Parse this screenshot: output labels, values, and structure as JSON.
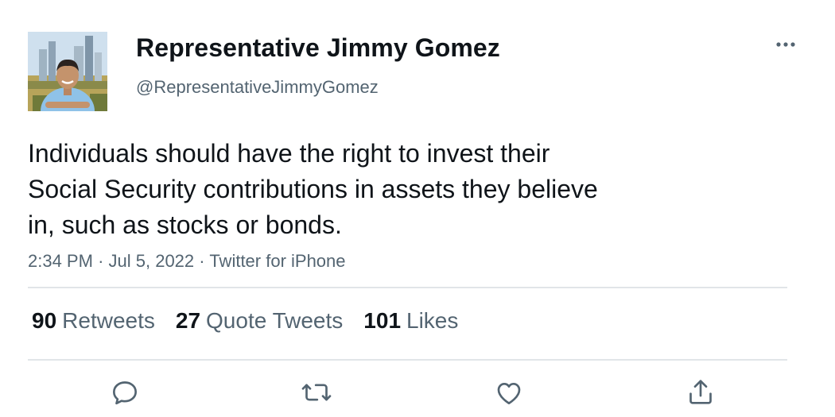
{
  "author": {
    "display_name": "Representative Jimmy Gomez",
    "handle": "@RepresentativeJimmyGomez",
    "avatar_icon": "profile-photo"
  },
  "tweet": {
    "text": "Individuals should have the right to invest their\nSocial Security contributions in assets they believe\nin, such as stocks or bonds.",
    "time": "2:34 PM",
    "separator": "·",
    "date": "Jul 5, 2022",
    "source": "Twitter for iPhone"
  },
  "stats": [
    {
      "count": "90",
      "label": "Retweets"
    },
    {
      "count": "27",
      "label": "Quote Tweets"
    },
    {
      "count": "101",
      "label": "Likes"
    }
  ],
  "actions": {
    "reply_icon": "reply-icon",
    "retweet_icon": "retweet-icon",
    "like_icon": "heart-icon",
    "share_icon": "share-icon",
    "more_icon": "more-horizontal-icon"
  },
  "colors": {
    "text_primary": "#0f1419",
    "text_secondary": "#536471",
    "divider": "#e1e5e8"
  }
}
